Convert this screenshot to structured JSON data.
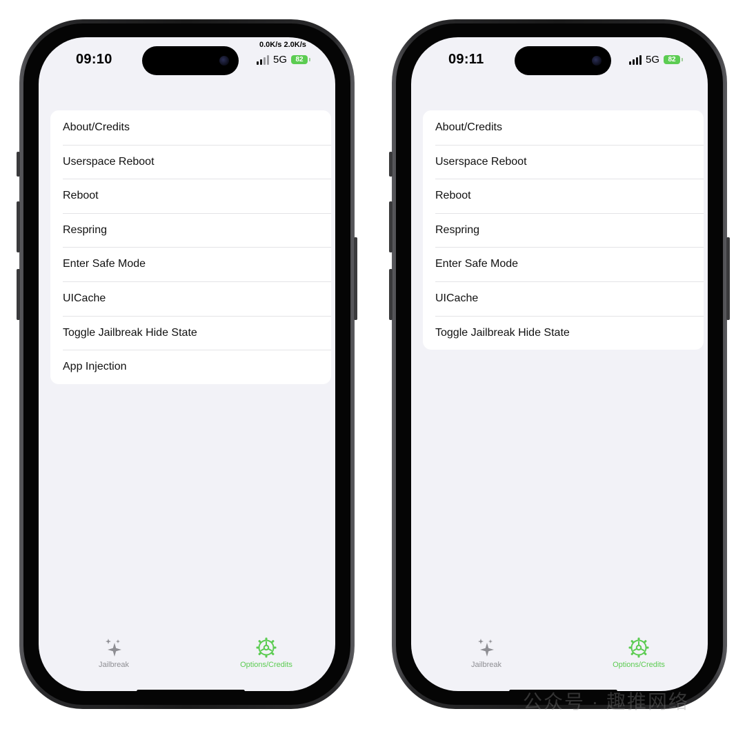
{
  "phones": [
    {
      "status": {
        "time": "09:10",
        "speed": "0.0K/s 2.0K/s",
        "network": "5G",
        "battery": "82"
      },
      "menu": [
        "About/Credits",
        "Userspace Reboot",
        "Reboot",
        "Respring",
        "Enter Safe Mode",
        "UICache",
        "Toggle Jailbreak Hide State",
        "App Injection"
      ],
      "tabs": [
        {
          "label": "Jailbreak",
          "icon": "sparkles-icon",
          "active": false
        },
        {
          "label": "Options/Credits",
          "icon": "gear-icon",
          "active": true
        }
      ]
    },
    {
      "status": {
        "time": "09:11",
        "network": "5G",
        "battery": "82"
      },
      "menu": [
        "About/Credits",
        "Userspace Reboot",
        "Reboot",
        "Respring",
        "Enter Safe Mode",
        "UICache",
        "Toggle Jailbreak Hide State"
      ],
      "tabs": [
        {
          "label": "Jailbreak",
          "icon": "sparkles-icon",
          "active": false
        },
        {
          "label": "Options/Credits",
          "icon": "gear-icon",
          "active": true
        }
      ]
    }
  ],
  "watermark": "公众号 · 趣推网络",
  "colors": {
    "accent": "#5ccc52",
    "background": "#f2f2f7",
    "inactive_tab": "#8e8e93"
  }
}
